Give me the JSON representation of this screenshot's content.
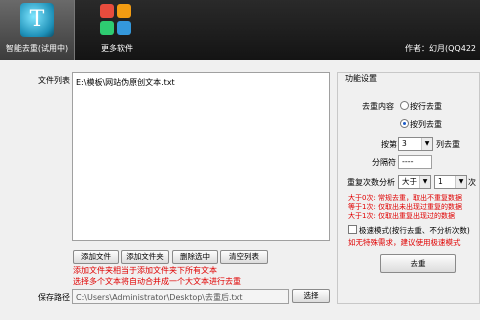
{
  "toolbar": {
    "tool1_label": "智能去重(试用中)",
    "tool1_icon_text": "T",
    "tool2_label": "更多软件",
    "author": "作者：幻月(QQ422"
  },
  "main": {
    "file_list_label": "文件列表",
    "file_list_items": [
      "E:\\模板\\网站伪原创文本.txt"
    ],
    "buttons": {
      "add_file": "添加文件",
      "add_folder": "添加文件夹",
      "delete_selected": "删除选中",
      "clear_list": "清空列表"
    },
    "notes": [
      "添加文件夹相当于添加文件夹下所有文本",
      "选择多个文本将自动合并成一个大文本进行去重"
    ],
    "save_path_label": "保存路径",
    "save_path_value": "C:\\Users\\Administrator\\Desktop\\去重后.txt",
    "browse_button": "选择"
  },
  "settings": {
    "title": "功能设置",
    "dedup_content_label": "去重内容",
    "option_by_line": "按行去重",
    "option_by_column": "按列去重",
    "column_prefix": "按第",
    "column_value": "3",
    "column_suffix": "列去重",
    "separator_label": "分隔符",
    "separator_value": "----",
    "repeat_label": "重复次数分析",
    "compare_value": "大于",
    "count_value": "1",
    "count_unit": "次",
    "info_lines": [
      "大于0次: 常规去重，取出不重复数据",
      "等于1次: 仅取出未出现过重复的数据",
      "大于1次: 仅取出重复出现过的数据"
    ],
    "fast_mode_label": "极速模式(按行去重、不分析次数)",
    "fast_mode_note": "如无特殊需求，建议使用极速模式",
    "run_button": "去重"
  }
}
